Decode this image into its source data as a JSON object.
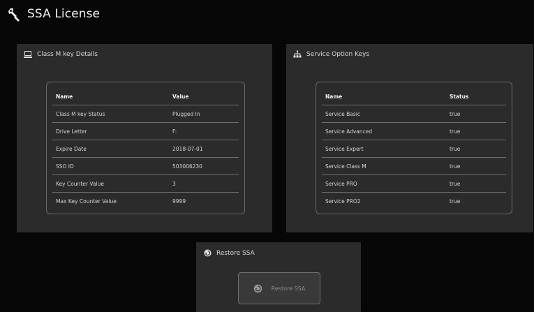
{
  "page": {
    "title": "SSA License"
  },
  "left_panel": {
    "title": "Class M key Details",
    "headers": {
      "name": "Name",
      "value": "Value"
    },
    "rows": [
      {
        "name": "Class M key Status",
        "value": "Plugged In"
      },
      {
        "name": "Drive Letter",
        "value": "F:"
      },
      {
        "name": "Expire Date",
        "value": "2018-07-01"
      },
      {
        "name": "SSO ID",
        "value": "503006230"
      },
      {
        "name": "Key Counter Value",
        "value": "3"
      },
      {
        "name": "Max Key Counter Value",
        "value": "9999"
      }
    ]
  },
  "right_panel": {
    "title": "Service Option Keys",
    "headers": {
      "name": "Name",
      "status": "Status"
    },
    "rows": [
      {
        "name": "Service Basic",
        "status": "true"
      },
      {
        "name": "Service Advanced",
        "status": "true"
      },
      {
        "name": "Service Expert",
        "status": "true"
      },
      {
        "name": "Service Class M",
        "status": "true"
      },
      {
        "name": "Service PRO",
        "status": "true"
      },
      {
        "name": "Service PRO2",
        "status": "true"
      }
    ]
  },
  "restore_panel": {
    "title": "Restore SSA",
    "button_label": "Restore SSA"
  },
  "icons": {
    "page": "wrench-icon",
    "left_panel": "computer-icon",
    "right_panel": "hierarchy-icon",
    "restore_panel": "restore-icon",
    "restore_button": "restore-icon"
  },
  "colors": {
    "background": "#070707",
    "panel": "#2b2b2b",
    "border": "#6f6f6f",
    "text": "#d3d3d3",
    "header_text": "#f5f5f5",
    "button": "#393939",
    "button_text": "#8e8e8e"
  }
}
